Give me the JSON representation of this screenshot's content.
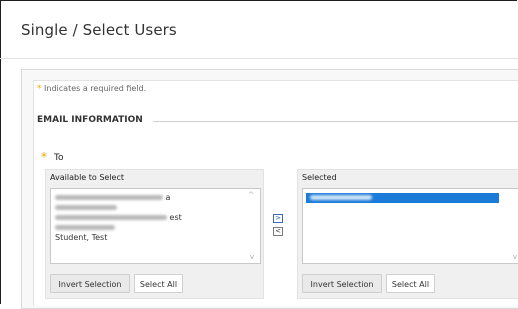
{
  "page": {
    "title": "Single / Select Users"
  },
  "form": {
    "required_star": "*",
    "required_note": "Indicates a required field.",
    "section_title": "EMAIL INFORMATION",
    "to_star": "*",
    "to_label": "To"
  },
  "available": {
    "header": "Available to Select",
    "items": [
      {
        "visible_text": "a"
      },
      {
        "visible_text": ""
      },
      {
        "visible_text": "est"
      },
      {
        "visible_text": ""
      },
      {
        "visible_text": "Student, Test"
      }
    ],
    "invert_label": "Invert Selection",
    "select_all_label": "Select All"
  },
  "selected": {
    "header": "Selected",
    "items": [
      {
        "visible_text": ""
      }
    ],
    "invert_label": "Invert Selection",
    "select_all_label": "Select All"
  },
  "move": {
    "right_glyph": ">",
    "left_glyph": "<"
  },
  "colors": {
    "required_star": "#f2a400",
    "selected_row": "#1d7bd8"
  }
}
